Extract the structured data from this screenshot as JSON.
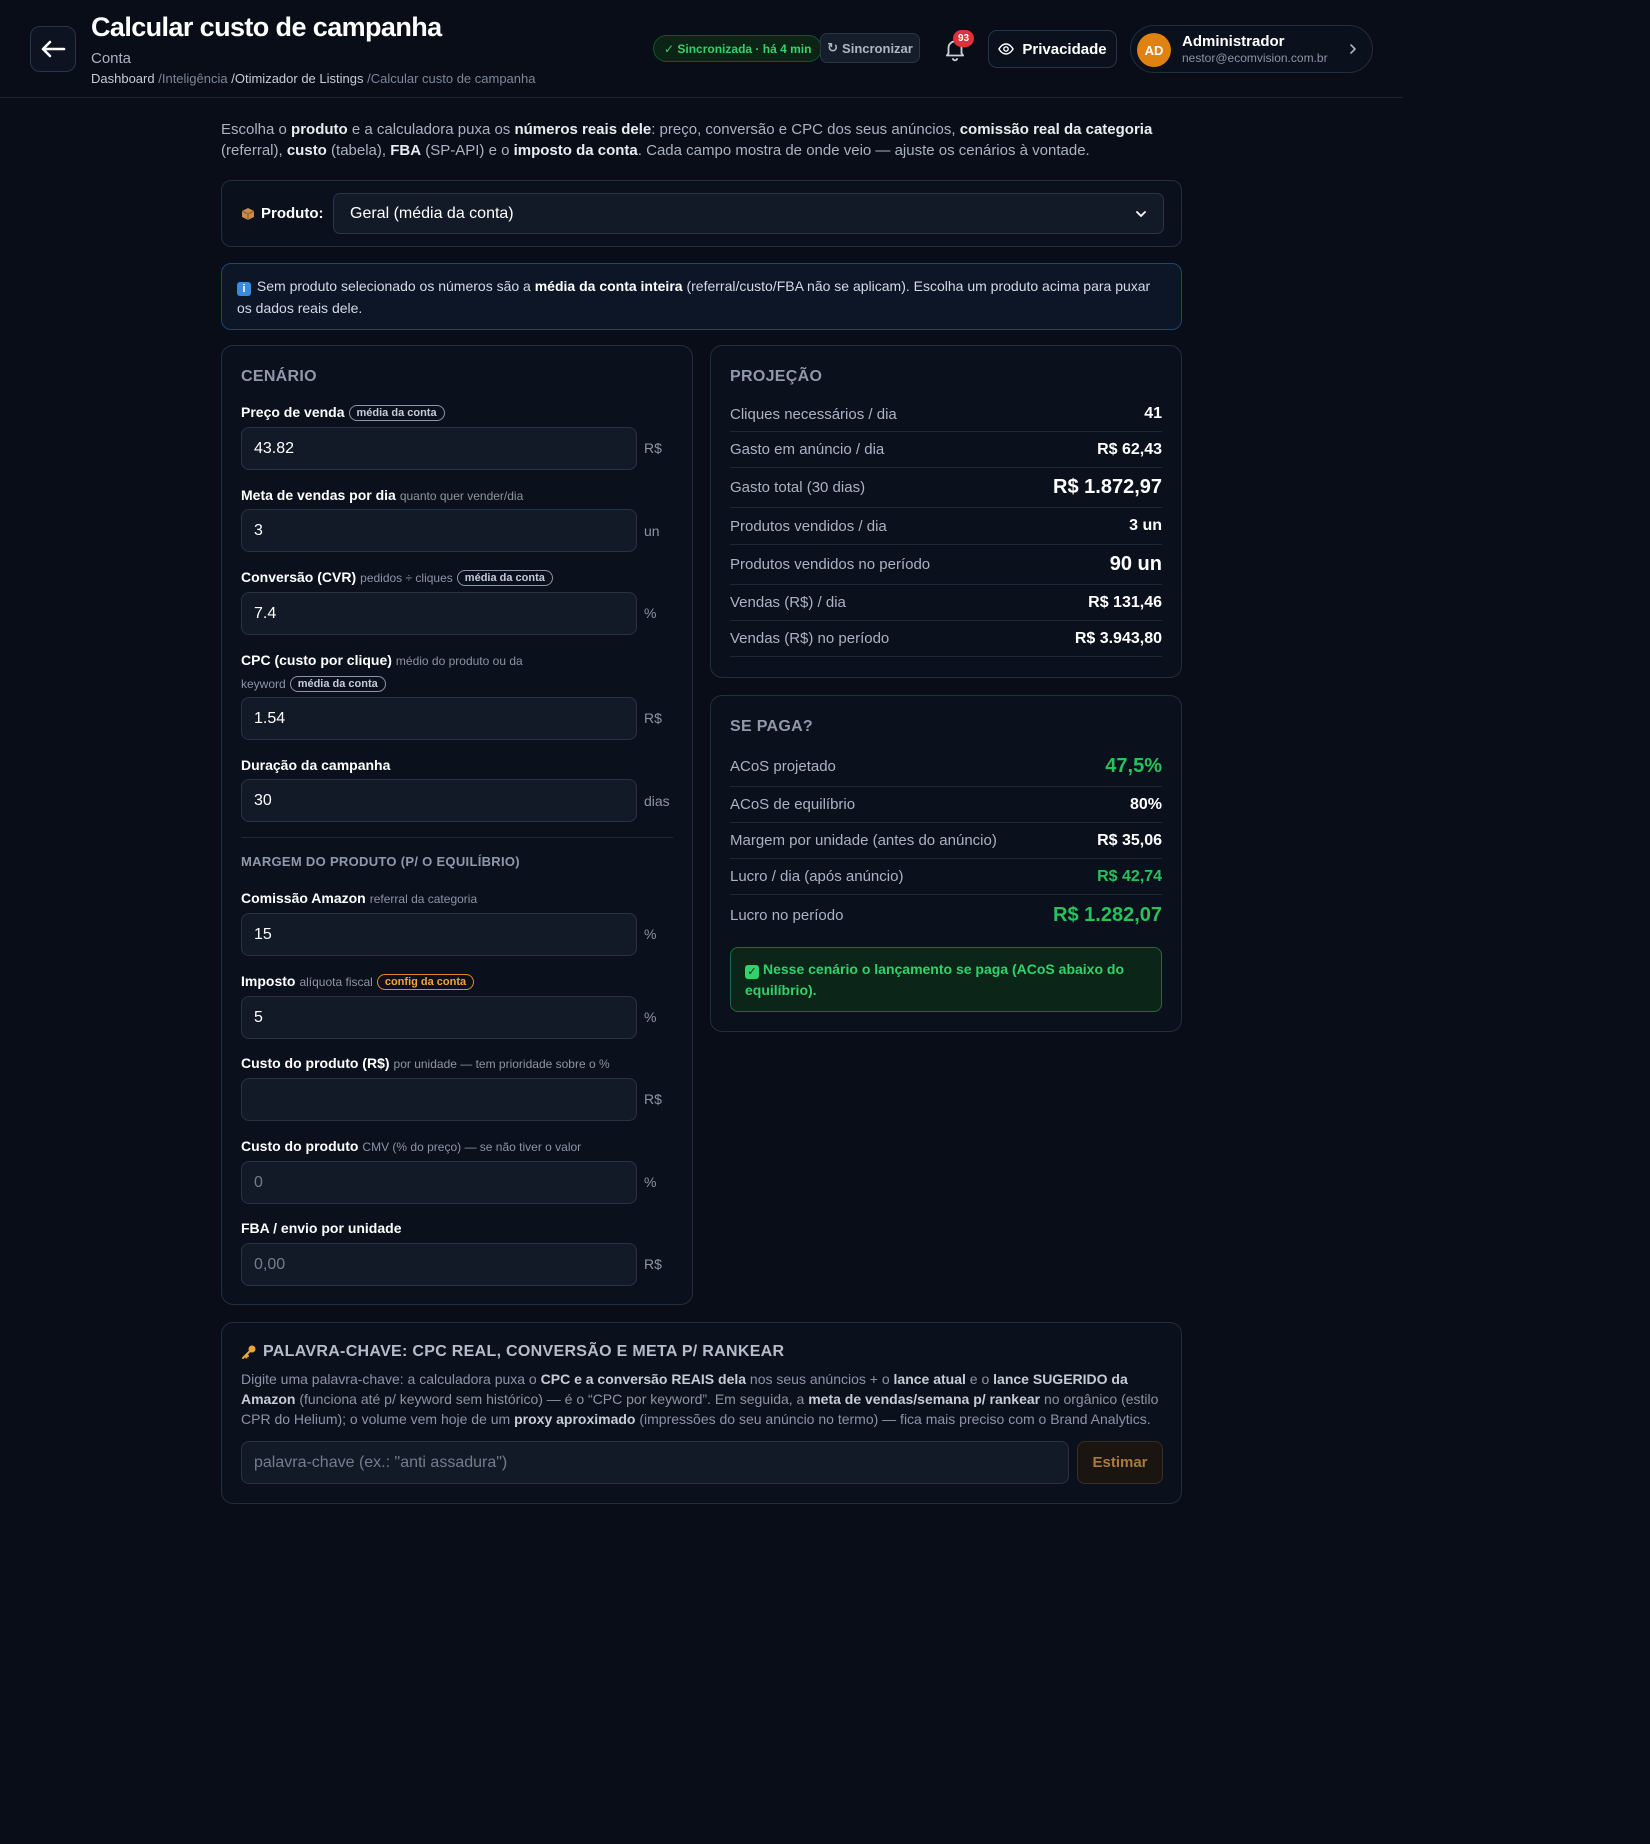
{
  "header": {
    "title": "Calcular custo de campanha",
    "subtitle": "Conta",
    "breadcrumb": [
      "Dashboard",
      "/Inteligência",
      "/Otimizador de Listings",
      "/Calcular custo de campanha"
    ],
    "sync_status": "✓ Sincronizada · há 4 min",
    "sync_button": "Sincronizar",
    "notifications_count": "93",
    "privacy_button": "Privacidade",
    "user": {
      "initials": "AD",
      "name": "Administrador",
      "email": "nestor@ecomvision.com.br"
    }
  },
  "intro": {
    "p1": "Escolha o ",
    "b1": "produto",
    "p2": " e a calculadora puxa os ",
    "b2": "números reais dele",
    "p3": ": preço, conversão e CPC dos seus anúncios, ",
    "b3": "comissão real da categoria",
    "p4": " (referral), ",
    "b4": "custo",
    "p5": " (tabela), ",
    "b5": "FBA",
    "p6": " (SP-API) e o ",
    "b6": "imposto da conta",
    "p7": ". Cada campo mostra de onde veio — ajuste os cenários à vontade."
  },
  "product": {
    "label": "Produto:",
    "selected": "Geral (média da conta)"
  },
  "info": {
    "icon": "i",
    "p1": "Sem produto selecionado os números são a ",
    "b1": "média da conta inteira",
    "p2": " (referral/custo/FBA não se aplicam). Escolha um produto acima para puxar os dados reais dele."
  },
  "scenario": {
    "title": "CENÁRIO",
    "fields": [
      {
        "label": "Preço de venda",
        "hint": "",
        "tag": "média da conta",
        "value": "43.82",
        "unit": "R$"
      },
      {
        "label": "Meta de vendas por dia",
        "hint": "quanto quer vender/dia",
        "tag": "",
        "value": "3",
        "unit": "un"
      },
      {
        "label": "Conversão (CVR)",
        "hint": "pedidos ÷ cliques",
        "tag": "média da conta",
        "value": "7.4",
        "unit": "%"
      },
      {
        "label": "CPC (custo por clique)",
        "hint": "médio do produto ou da",
        "hint2": "keyword",
        "tag": "média da conta",
        "value": "1.54",
        "unit": "R$"
      },
      {
        "label": "Duração da campanha",
        "hint": "",
        "tag": "",
        "value": "30",
        "unit": "dias"
      }
    ],
    "margin_title": "MARGEM DO PRODUTO (P/ O EQUILÍBRIO)",
    "margin_fields": [
      {
        "label": "Comissão Amazon",
        "hint": "referral da categoria",
        "tag": "",
        "value": "15",
        "unit": "%"
      },
      {
        "label": "Imposto",
        "hint": "alíquota fiscal",
        "tag": "config da conta",
        "value": "5",
        "unit": "%"
      },
      {
        "label": "Custo do produto (R$)",
        "hint": "por unidade — tem prioridade sobre o %",
        "tag": "",
        "value": "",
        "unit": "R$"
      },
      {
        "label": "Custo do produto",
        "hint": "CMV (% do preço) — se não tiver o valor",
        "tag": "",
        "placeholder": "0",
        "unit": "%"
      },
      {
        "label": "FBA / envio por unidade",
        "hint": "",
        "tag": "",
        "placeholder": "0,00",
        "unit": "R$"
      }
    ]
  },
  "projection": {
    "title": "PROJEÇÃO",
    "rows": [
      {
        "label": "Cliques necessários / dia",
        "value": "41"
      },
      {
        "label": "Gasto em anúncio / dia",
        "value": "R$ 62,43"
      },
      {
        "label": "Gasto total (30 dias)",
        "value": "R$ 1.872,97"
      },
      {
        "label": "Produtos vendidos / dia",
        "value": "3 un"
      },
      {
        "label": "Produtos vendidos no período",
        "value": "90 un"
      },
      {
        "label": "Vendas (R$) / dia",
        "value": "R$ 131,46"
      },
      {
        "label": "Vendas (R$) no período",
        "value": "R$ 3.943,80"
      }
    ]
  },
  "payback": {
    "title": "SE PAGA?",
    "rows": [
      {
        "label": "ACoS projetado",
        "value": "47,5%"
      },
      {
        "label": "ACoS de equilíbrio",
        "value": "80%"
      },
      {
        "label": "Margem por unidade (antes do anúncio)",
        "value": "R$ 35,06"
      },
      {
        "label": "Lucro / dia (após anúncio)",
        "value": "R$ 42,74"
      },
      {
        "label": "Lucro no período",
        "value": "R$ 1.282,07"
      }
    ],
    "verdict": "Nesse cenário o lançamento se paga (ACoS abaixo do equilíbrio).",
    "accent_green": "#27c25c"
  },
  "keyword": {
    "title": "PALAVRA-CHAVE: CPC REAL, CONVERSÃO E META P/ RANKEAR",
    "d1": "Digite uma palavra-chave: a calculadora puxa o ",
    "b1": "CPC e a conversão REAIS dela",
    "d2": " nos seus anúncios + o ",
    "b2": "lance atual",
    "d3": " e o ",
    "b3": "lance SUGERIDO da Amazon",
    "d4": " (funciona até p/ keyword sem histórico) — é o “CPC por keyword”. Em seguida, a ",
    "b4": "meta de vendas/semana p/ rankear",
    "d5": " no orgânico (estilo CPR do Helium); o volume vem hoje de um ",
    "b5": "proxy aproximado",
    "d6": " (impressões do seu anúncio no termo) — fica mais preciso com o Brand Analytics.",
    "placeholder": "palavra-chave (ex.: \"anti assadura\")",
    "button": "Estimar"
  }
}
